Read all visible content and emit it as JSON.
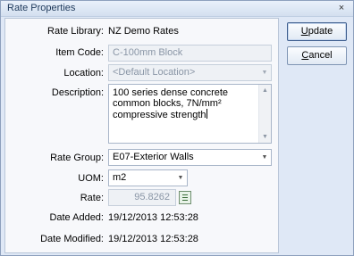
{
  "window": {
    "title": "Rate Properties",
    "close_glyph": "×"
  },
  "form": {
    "rate_library": {
      "label": "Rate Library:",
      "value": "NZ Demo Rates"
    },
    "item_code": {
      "label": "Item Code:",
      "value": "C-100mm Block"
    },
    "location": {
      "label": "Location:",
      "value": "<Default Location>"
    },
    "description": {
      "label": "Description:",
      "value": "100 series dense concrete common blocks, 7N/mm² compressive strength"
    },
    "rate_group": {
      "label": "Rate Group:",
      "value": "E07-Exterior Walls"
    },
    "uom": {
      "label": "UOM:",
      "value": "m2"
    },
    "rate": {
      "label": "Rate:",
      "value": "95.8262"
    },
    "date_added": {
      "label": "Date Added:",
      "value": "19/12/2013 12:53:28"
    },
    "date_modified": {
      "label": "Date Modified:",
      "value": "19/12/2013 12:53:28"
    }
  },
  "buttons": {
    "update": {
      "accel": "U",
      "rest": "pdate"
    },
    "cancel": {
      "accel": "C",
      "rest": "ancel"
    }
  },
  "icons": {
    "dropdown": "chevron-down-icon",
    "calculator": "calculator-icon"
  },
  "colors": {
    "window_bg": "#dfe8f6",
    "panel_bg": "#f7f8fb",
    "border": "#8da0bd"
  }
}
